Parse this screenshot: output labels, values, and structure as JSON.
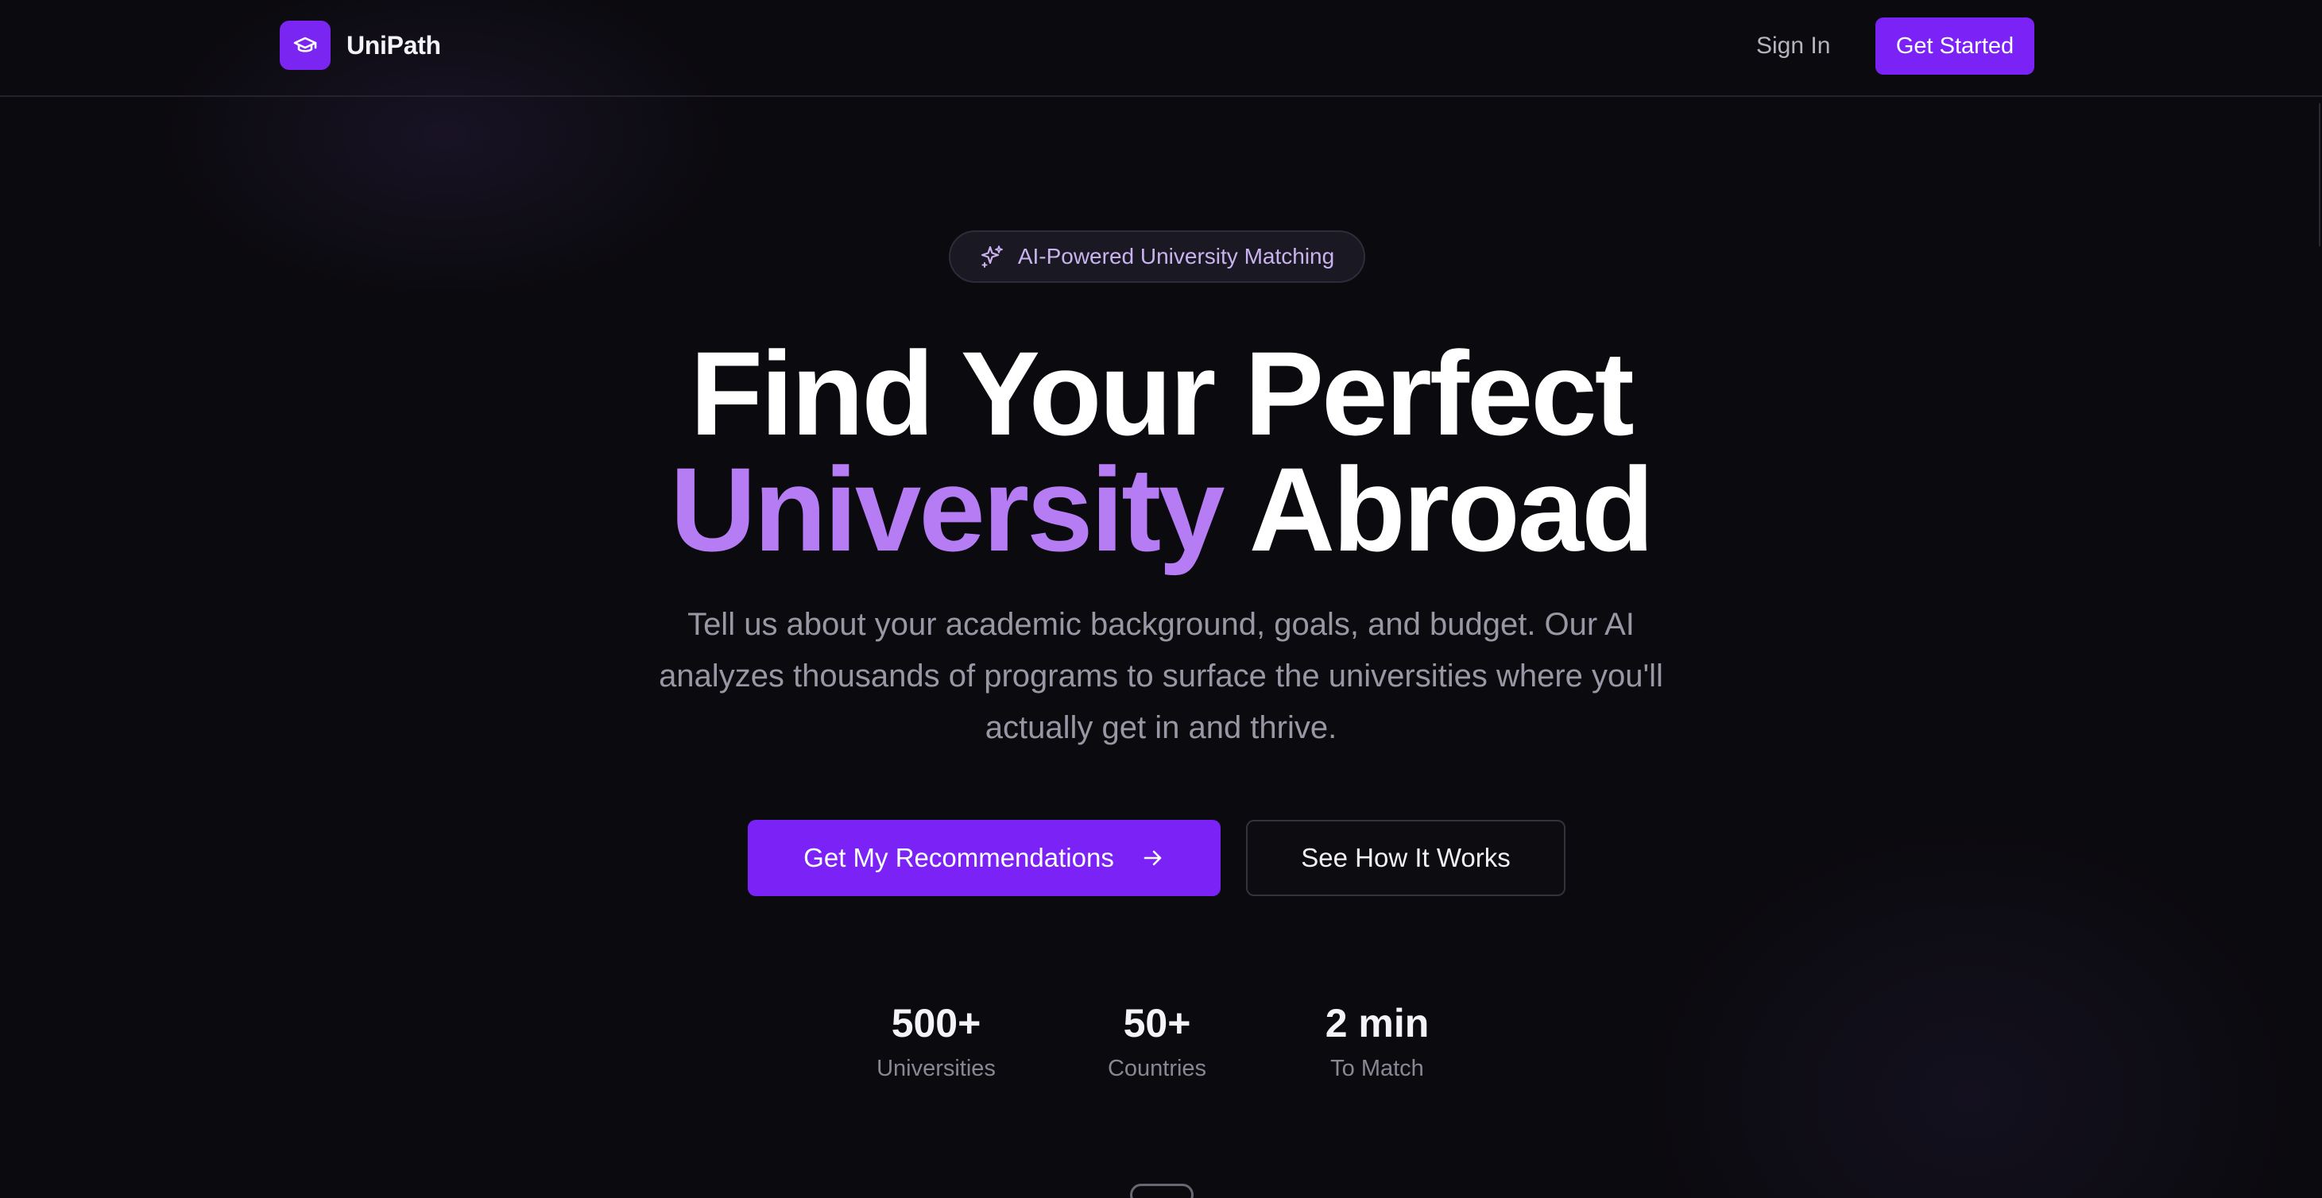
{
  "nav": {
    "brand_name": "UniPath",
    "brand_icon": "graduation-cap-icon",
    "sign_in_label": "Sign In",
    "get_started_label": "Get Started"
  },
  "hero": {
    "badge_icon": "sparkles-icon",
    "badge_text": "AI-Powered University Matching",
    "headline_line1": "Find Your Perfect",
    "headline_line2_accent": "University",
    "headline_line2_rest": "Abroad",
    "subtitle": "Tell us about your academic background, goals, and budget. Our AI analyzes thousands of programs to surface the universities where you'll actually get in and thrive.",
    "primary_cta_label": "Get My Recommendations",
    "primary_cta_icon": "arrow-right-icon",
    "secondary_cta_label": "See How It Works"
  },
  "stats": [
    {
      "value": "500+",
      "label": "Universities"
    },
    {
      "value": "50+",
      "label": "Countries"
    },
    {
      "value": "2 min",
      "label": "To Match"
    }
  ],
  "colors": {
    "background": "#0b0a0e",
    "accent": "#7b22f7",
    "accent_text": "#b57cf4",
    "muted_text": "#9a97a4"
  }
}
